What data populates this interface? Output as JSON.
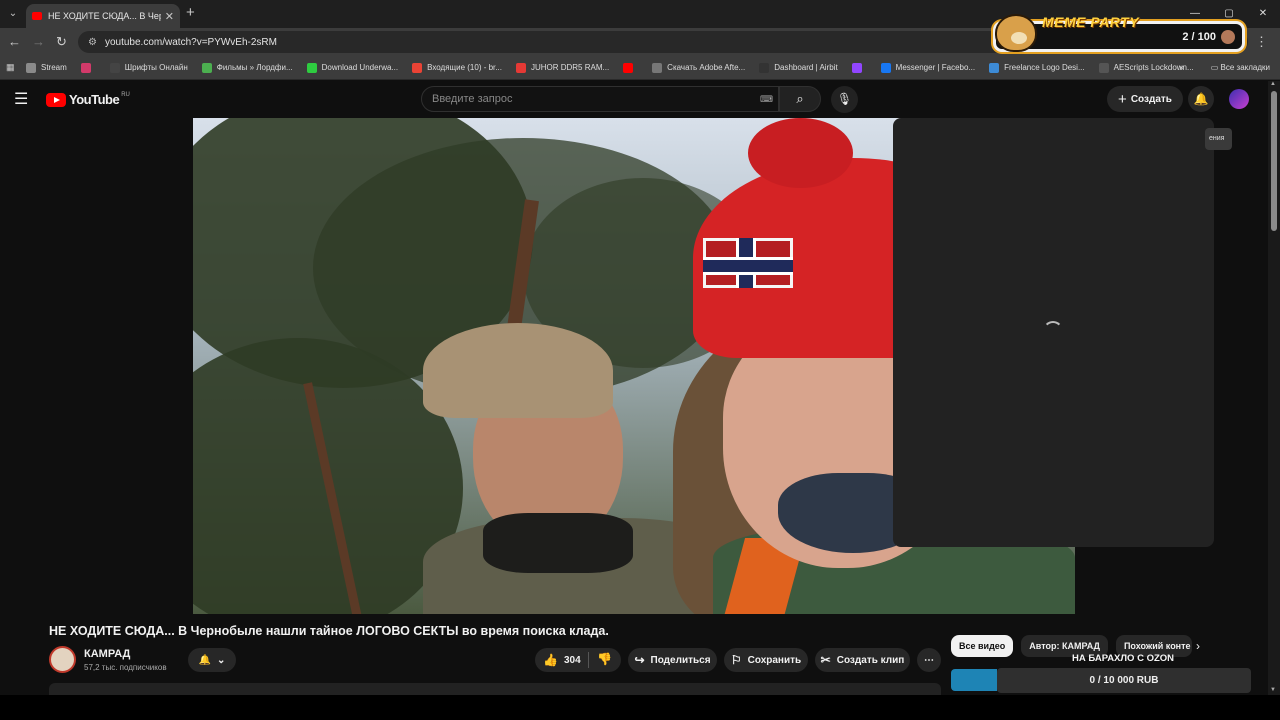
{
  "browser": {
    "tab_title": "НЕ ХОДИТЕ СЮДА... В Чернобыле",
    "url": "youtube.com/watch?v=PYWvEh-2sRM",
    "bookmarks": [
      {
        "label": "Stream",
        "icon": "folder-icon",
        "color": "#8a8a8a"
      },
      {
        "label": "",
        "icon": "site-icon",
        "color": "#d23a6a"
      },
      {
        "label": "Шрифты Онлайн",
        "icon": "site-icon",
        "color": "#444444"
      },
      {
        "label": "Фильмы » Лордфи...",
        "icon": "site-icon",
        "color": "#4caf50"
      },
      {
        "label": "Download Underwa...",
        "icon": "site-icon",
        "color": "#2ecc40"
      },
      {
        "label": "Входящие (10) - br...",
        "icon": "gmail-icon",
        "color": "#ea4335"
      },
      {
        "label": "JUHOR DDR5 RAM...",
        "icon": "site-icon",
        "color": "#e53935"
      },
      {
        "label": "",
        "icon": "youtube-icon",
        "color": "#ff0000"
      },
      {
        "label": "Скачать Adobe Afte...",
        "icon": "site-icon",
        "color": "#777777"
      },
      {
        "label": "Dashboard | Airbit",
        "icon": "site-icon",
        "color": "#333333"
      },
      {
        "label": "",
        "icon": "twitch-icon",
        "color": "#9146ff"
      },
      {
        "label": "Messenger | Facebo...",
        "icon": "facebook-icon",
        "color": "#1877f2"
      },
      {
        "label": "Freelance Logo Desi...",
        "icon": "site-icon",
        "color": "#3d8bd6"
      },
      {
        "label": "AEScripts Lockdown...",
        "icon": "site-icon",
        "color": "#555555"
      }
    ],
    "all_bookmarks": "Все закладки"
  },
  "meme_party": {
    "title": "MEME PARTY",
    "count": "2 / 100"
  },
  "youtube": {
    "logo_text": "YouTube",
    "region": "RU",
    "search_placeholder": "Введите запрос",
    "create_label": "Создать"
  },
  "video": {
    "title": "НЕ ХОДИТЕ СЮДА... В Чернобыле нашли тайное ЛОГОВО СЕКТЫ во время поиска клада.",
    "channel": "КАМРАД",
    "subscribers": "57,2 тыс. подписчиков",
    "likes": "304",
    "share_label": "Поделиться",
    "save_label": "Сохранить",
    "clip_label": "Создать клип",
    "side_tag": "ения"
  },
  "chips": [
    "Все видео",
    "Автор: КАМРАД",
    "Похожий конте"
  ],
  "ozon": {
    "title": "НА БАРАХЛО С OZON",
    "progress": "0 / 10 000 RUB",
    "progress_fraction": 0
  }
}
